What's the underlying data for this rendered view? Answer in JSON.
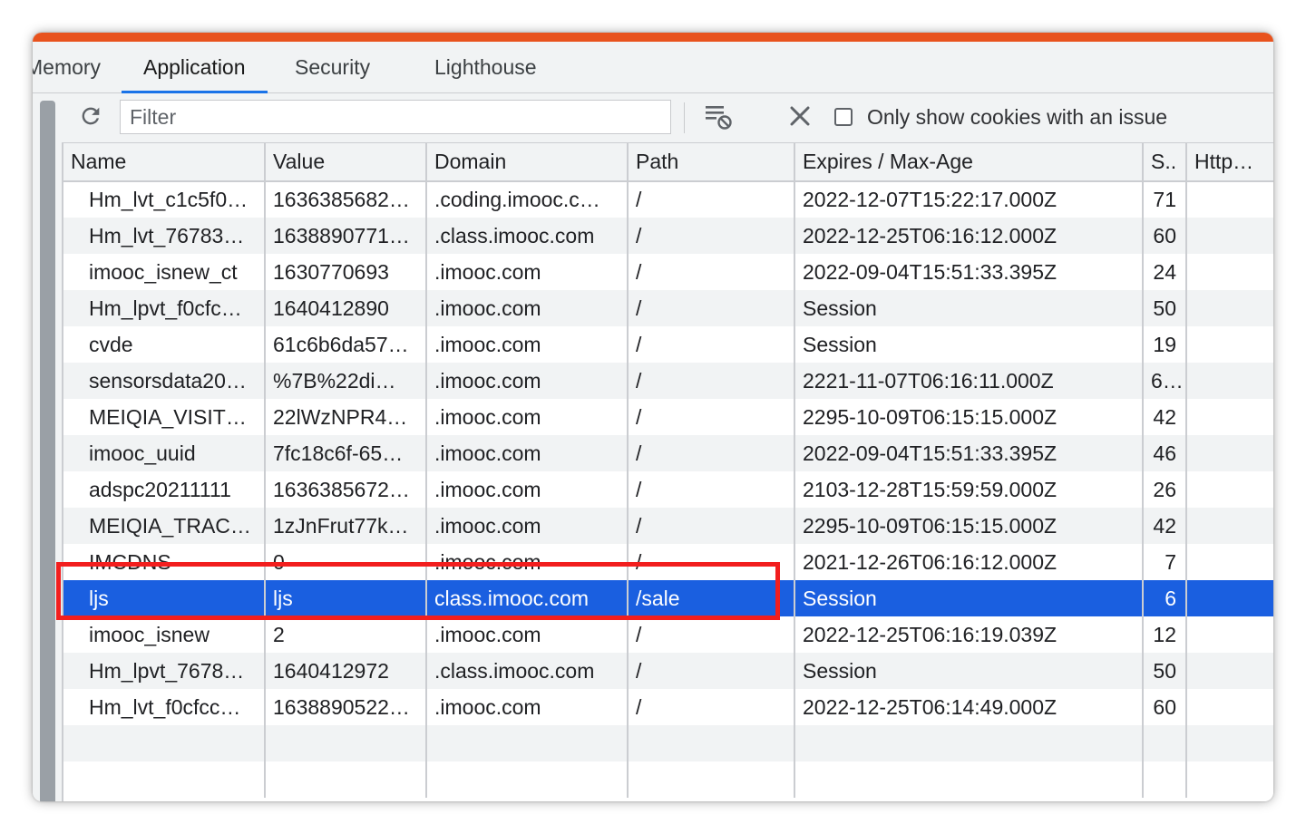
{
  "colors": {
    "accent_bar": "#e8521d",
    "tab_underline": "#1a73e8",
    "selected_row": "#1a5fe0",
    "annotation": "#f21e1e"
  },
  "tabs": [
    {
      "label": "Memory",
      "active": false
    },
    {
      "label": "Application",
      "active": true
    },
    {
      "label": "Security",
      "active": false
    },
    {
      "label": "Lighthouse",
      "active": false
    }
  ],
  "toolbar": {
    "refresh_icon": "refresh-icon",
    "filter_placeholder": "Filter",
    "filter_value": "",
    "clear_filtered_icon": "clear-filtered-icon",
    "delete_icon": "close-icon",
    "checkbox_label": "Only show cookies with an issue",
    "checkbox_checked": false
  },
  "table": {
    "columns": [
      "Name",
      "Value",
      "Domain",
      "Path",
      "Expires / Max-Age",
      "S..",
      "Http…"
    ],
    "rows": [
      {
        "name": "Hm_lvt_c1c5f0…",
        "value": "1636385682…",
        "domain": ".coding.imooc.c…",
        "path": "/",
        "expires": "2022-12-07T15:22:17.000Z",
        "size": "71",
        "http": ""
      },
      {
        "name": "Hm_lvt_76783…",
        "value": "1638890771…",
        "domain": ".class.imooc.com",
        "path": "/",
        "expires": "2022-12-25T06:16:12.000Z",
        "size": "60",
        "http": ""
      },
      {
        "name": "imooc_isnew_ct",
        "value": "1630770693",
        "domain": ".imooc.com",
        "path": "/",
        "expires": "2022-09-04T15:51:33.395Z",
        "size": "24",
        "http": ""
      },
      {
        "name": "Hm_lpvt_f0cfc…",
        "value": "1640412890",
        "domain": ".imooc.com",
        "path": "/",
        "expires": "Session",
        "size": "50",
        "http": ""
      },
      {
        "name": "cvde",
        "value": "61c6b6da57…",
        "domain": ".imooc.com",
        "path": "/",
        "expires": "Session",
        "size": "19",
        "http": ""
      },
      {
        "name": "sensorsdata20…",
        "value": "%7B%22di…",
        "domain": ".imooc.com",
        "path": "/",
        "expires": "2221-11-07T06:16:11.000Z",
        "size": "6…",
        "http": ""
      },
      {
        "name": "MEIQIA_VISIT…",
        "value": "22lWzNPR4…",
        "domain": ".imooc.com",
        "path": "/",
        "expires": "2295-10-09T06:15:15.000Z",
        "size": "42",
        "http": ""
      },
      {
        "name": "imooc_uuid",
        "value": "7fc18c6f-65…",
        "domain": ".imooc.com",
        "path": "/",
        "expires": "2022-09-04T15:51:33.395Z",
        "size": "46",
        "http": ""
      },
      {
        "name": "adspc20211111",
        "value": "1636385672…",
        "domain": ".imooc.com",
        "path": "/",
        "expires": "2103-12-28T15:59:59.000Z",
        "size": "26",
        "http": ""
      },
      {
        "name": "MEIQIA_TRAC…",
        "value": "1zJnFrut77k…",
        "domain": ".imooc.com",
        "path": "/",
        "expires": "2295-10-09T06:15:15.000Z",
        "size": "42",
        "http": ""
      },
      {
        "name": "IMCDNS",
        "value": "0",
        "domain": ".imooc.com",
        "path": "/",
        "expires": "2021-12-26T06:16:12.000Z",
        "size": "7",
        "http": ""
      },
      {
        "name": "ljs",
        "value": "ljs",
        "domain": "class.imooc.com",
        "path": "/sale",
        "expires": "Session",
        "size": "6",
        "http": "",
        "selected": true
      },
      {
        "name": "imooc_isnew",
        "value": "2",
        "domain": ".imooc.com",
        "path": "/",
        "expires": "2022-12-25T06:16:19.039Z",
        "size": "12",
        "http": ""
      },
      {
        "name": "Hm_lpvt_7678…",
        "value": "1640412972",
        "domain": ".class.imooc.com",
        "path": "/",
        "expires": "Session",
        "size": "50",
        "http": ""
      },
      {
        "name": "Hm_lvt_f0cfcc…",
        "value": "1638890522…",
        "domain": ".imooc.com",
        "path": "/",
        "expires": "2022-12-25T06:14:49.000Z",
        "size": "60",
        "http": ""
      },
      {
        "name": "",
        "value": "",
        "domain": "",
        "path": "",
        "expires": "",
        "size": "",
        "http": ""
      },
      {
        "name": "",
        "value": "",
        "domain": "",
        "path": "",
        "expires": "",
        "size": "",
        "http": ""
      }
    ]
  }
}
